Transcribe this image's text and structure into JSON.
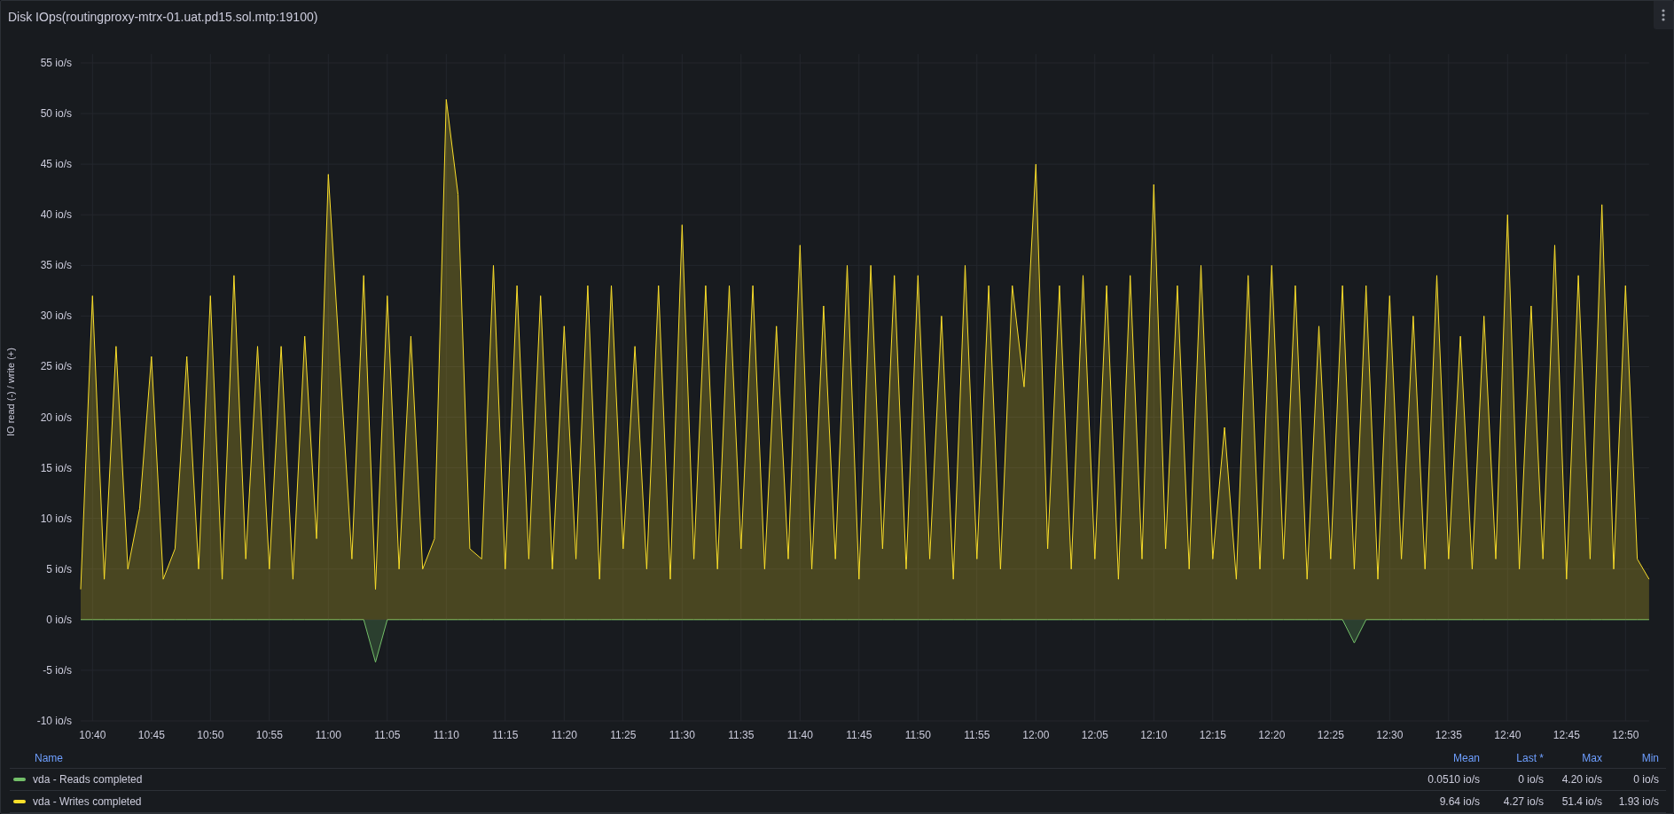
{
  "panel": {
    "title": "Disk IOps(routingproxy-mtrx-01.uat.pd15.sol.mtp:19100)",
    "chart_data": {
      "type": "area",
      "ylabel": "IO read (-) / write (+)",
      "grid": true,
      "categories": [
        null,
        "10:40",
        null,
        null,
        null,
        null,
        "10:45",
        null,
        null,
        null,
        null,
        "10:50",
        null,
        null,
        null,
        null,
        "10:55",
        null,
        null,
        null,
        null,
        "11:00",
        null,
        null,
        null,
        null,
        "11:05",
        null,
        null,
        null,
        null,
        "11:10",
        null,
        null,
        null,
        null,
        "11:15",
        null,
        null,
        null,
        null,
        "11:20",
        null,
        null,
        null,
        null,
        "11:25",
        null,
        null,
        null,
        null,
        "11:30",
        null,
        null,
        null,
        null,
        "11:35",
        null,
        null,
        null,
        null,
        "11:40",
        null,
        null,
        null,
        null,
        "11:45",
        null,
        null,
        null,
        null,
        "11:50",
        null,
        null,
        null,
        null,
        "11:55",
        null,
        null,
        null,
        null,
        "12:00",
        null,
        null,
        null,
        null,
        "12:05",
        null,
        null,
        null,
        null,
        "12:10",
        null,
        null,
        null,
        null,
        "12:15",
        null,
        null,
        null,
        null,
        "12:20",
        null,
        null,
        null,
        null,
        "12:25",
        null,
        null,
        null,
        null,
        "12:30",
        null,
        null,
        null,
        null,
        "12:35",
        null,
        null,
        null,
        null,
        "12:40",
        null,
        null,
        null,
        null,
        "12:45",
        null,
        null,
        null,
        null,
        "12:50",
        null,
        null
      ],
      "series": [
        {
          "name": "vda - Reads completed",
          "color": "#73bf69",
          "values": [
            0,
            0,
            0,
            0,
            0,
            0,
            0,
            0,
            0,
            0,
            0,
            0,
            0,
            0,
            0,
            0,
            0,
            0,
            0,
            0,
            0,
            0,
            0,
            0,
            0,
            -4.2,
            0,
            0,
            0,
            0,
            0,
            0,
            0,
            0,
            0,
            0,
            0,
            0,
            0,
            0,
            0,
            0,
            0,
            0,
            0,
            0,
            0,
            0,
            0,
            0,
            0,
            0,
            0,
            0,
            0,
            0,
            0,
            0,
            0,
            0,
            0,
            0,
            0,
            0,
            0,
            0,
            0,
            0,
            0,
            0,
            0,
            0,
            0,
            0,
            0,
            0,
            0,
            0,
            0,
            0,
            0,
            0,
            0,
            0,
            0,
            0,
            0,
            0,
            0,
            0,
            0,
            0,
            0,
            0,
            0,
            0,
            0,
            0,
            0,
            0,
            0,
            0,
            0,
            0,
            0,
            0,
            0,
            0,
            -2.3,
            0,
            0,
            0,
            0,
            0,
            0,
            0,
            0,
            0,
            0,
            0,
            0,
            0,
            0,
            0,
            0,
            0,
            0,
            0,
            0,
            0,
            0,
            0,
            0,
            0
          ]
        },
        {
          "name": "vda - Writes completed",
          "color": "#fade2a",
          "values": [
            3,
            32,
            4,
            27,
            5,
            11,
            26,
            4,
            7,
            26,
            5,
            32,
            4,
            34,
            6,
            27,
            5,
            27,
            4,
            28,
            8,
            44,
            25,
            6,
            34,
            3,
            32,
            5,
            28,
            5,
            8,
            51.4,
            42,
            7,
            6,
            35,
            5,
            33,
            6,
            32,
            5,
            29,
            6,
            33,
            4,
            33,
            7,
            27,
            5,
            33,
            4,
            39,
            6,
            33,
            5,
            33,
            7,
            33,
            5,
            29,
            6,
            37,
            5,
            31,
            6,
            35,
            4,
            35,
            7,
            34,
            5,
            34,
            6,
            30,
            4,
            35,
            6,
            33,
            5,
            33,
            23,
            45,
            7,
            33,
            5,
            34,
            6,
            33,
            4,
            34,
            6,
            43,
            7,
            33,
            5,
            35,
            6,
            19,
            4,
            34,
            5,
            35,
            6,
            33,
            4,
            29,
            6,
            33,
            5,
            33,
            4,
            32,
            6,
            30,
            5,
            34,
            6,
            28,
            5,
            30,
            6,
            40,
            5,
            31,
            6,
            37,
            4,
            34,
            6,
            41,
            5,
            33,
            6,
            4
          ]
        }
      ],
      "ylim": [
        -10,
        55
      ],
      "yticks": [
        {
          "value": 55,
          "label": "55 io/s"
        },
        {
          "value": 50,
          "label": "50 io/s"
        },
        {
          "value": 45,
          "label": "45 io/s"
        },
        {
          "value": 40,
          "label": "40 io/s"
        },
        {
          "value": 35,
          "label": "35 io/s"
        },
        {
          "value": 30,
          "label": "30 io/s"
        },
        {
          "value": 25,
          "label": "25 io/s"
        },
        {
          "value": 20,
          "label": "20 io/s"
        },
        {
          "value": 15,
          "label": "15 io/s"
        },
        {
          "value": 10,
          "label": "10 io/s"
        },
        {
          "value": 5,
          "label": "5 io/s"
        },
        {
          "value": 0,
          "label": "0 io/s"
        },
        {
          "value": -5,
          "label": "-5 io/s"
        },
        {
          "value": -10,
          "label": "-10 io/s"
        }
      ]
    }
  },
  "legend": {
    "columns": [
      "Name",
      "Mean",
      "Last *",
      "Max",
      "Min"
    ],
    "rows": [
      {
        "mean": "0.0510 io/s",
        "last": "0 io/s",
        "max": "4.20 io/s",
        "min": "0 io/s"
      },
      {
        "mean": "9.64 io/s",
        "last": "4.27 io/s",
        "max": "51.4 io/s",
        "min": "1.93 io/s"
      }
    ]
  }
}
